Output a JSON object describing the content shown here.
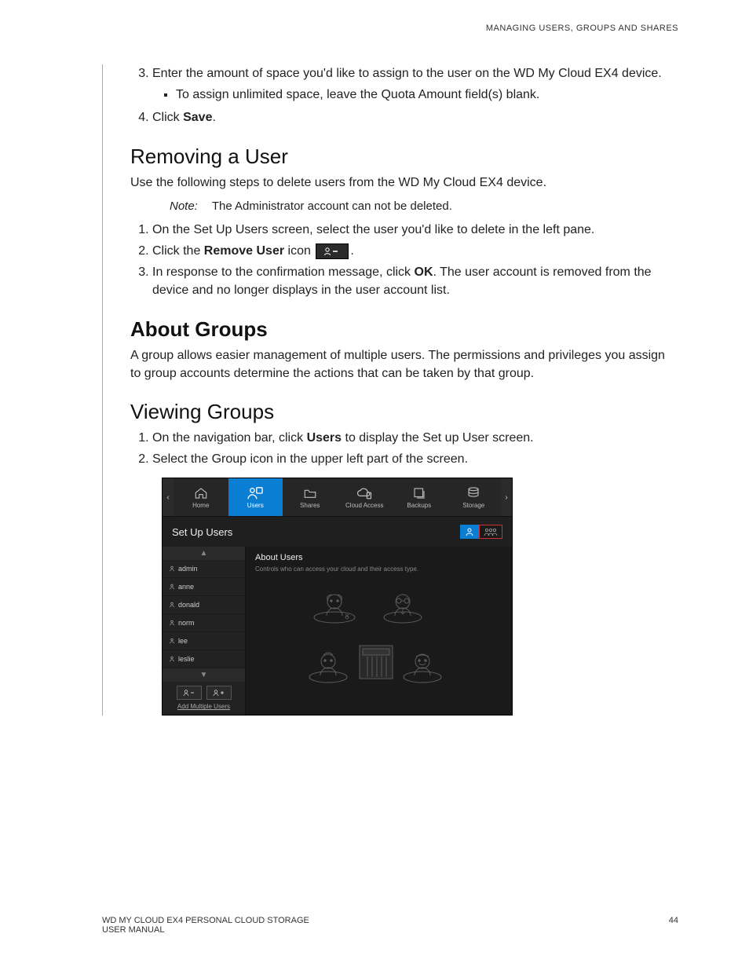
{
  "header": "MANAGING USERS, GROUPS AND SHARES",
  "steps1": {
    "s3_a": "Enter the amount of space you'd like to assign to the user on the WD My Cloud EX4 device.",
    "s3_bullet": "To assign unlimited space, leave the Quota Amount field(s) blank.",
    "s4_a": "Click ",
    "s4_b": "Save",
    "s4_c": "."
  },
  "removing": {
    "heading": "Removing a User",
    "intro": "Use the following steps to delete users from the WD My Cloud EX4 device.",
    "note_label": "Note:",
    "note_text": "The Administrator account can not be deleted.",
    "s1": "On the Set Up Users screen, select the user you'd like to delete in the left pane.",
    "s2_a": "Click the ",
    "s2_b": "Remove User",
    "s2_c": " icon ",
    "s2_d": ".",
    "s3_a": "In response to the confirmation message, click ",
    "s3_b": "OK",
    "s3_c": ". The user account is removed from the device and no longer displays in the user account list."
  },
  "about": {
    "heading": "About Groups",
    "intro": "A group allows easier management of multiple users. The permissions and privileges you assign to group accounts determine the actions that can be taken by that group."
  },
  "viewing": {
    "heading": "Viewing Groups",
    "s1_a": "On the navigation bar, click ",
    "s1_b": "Users",
    "s1_c": " to display the Set up User screen.",
    "s2": "Select the Group icon in the upper left part of the screen."
  },
  "shot": {
    "nav": {
      "home": "Home",
      "users": "Users",
      "shares": "Shares",
      "cloud": "Cloud Access",
      "backups": "Backups",
      "storage": "Storage"
    },
    "title": "Set Up Users",
    "users": [
      "admin",
      "anne",
      "donald",
      "norm",
      "lee",
      "leslie"
    ],
    "add_multiple": "Add Multiple Users",
    "panel_title": "About Users",
    "panel_sub": "Controls who can access your cloud and their access type."
  },
  "footer": {
    "left1": "WD MY CLOUD EX4 PERSONAL CLOUD STORAGE",
    "left2": "USER MANUAL",
    "page": "44"
  }
}
